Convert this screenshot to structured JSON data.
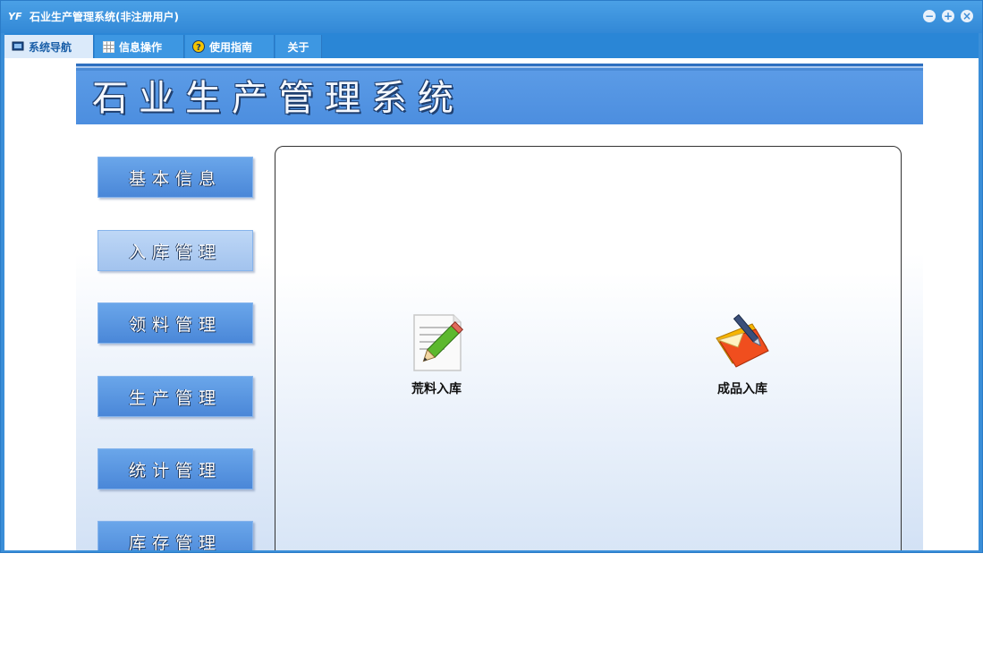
{
  "window": {
    "title": "石业生产管理系统(非注册用户)",
    "logo_text": "YF"
  },
  "controls": {
    "minimize": "−",
    "maximize": "+",
    "close": "×"
  },
  "menu": {
    "tabs": [
      {
        "label": "系统导航",
        "icon": "monitor-icon"
      },
      {
        "label": "信息操作",
        "icon": "grid-icon"
      },
      {
        "label": "使用指南",
        "icon": "help-icon"
      },
      {
        "label": "关于"
      }
    ]
  },
  "banner": {
    "title": "石业生产管理系统"
  },
  "sidebar": {
    "items": [
      {
        "label": "基本信息"
      },
      {
        "label": "入库管理"
      },
      {
        "label": "领料管理"
      },
      {
        "label": "生产管理"
      },
      {
        "label": "统计管理"
      },
      {
        "label": "库存管理"
      }
    ]
  },
  "panel": {
    "shortcuts": [
      {
        "label": "荒料入库",
        "icon": "document-pencil-icon"
      },
      {
        "label": "成品入库",
        "icon": "folder-pen-icon"
      }
    ]
  },
  "colors": {
    "title_bar": "#3a8ed8",
    "menu_bar": "#2a86d6",
    "banner": "#5393e3",
    "side_button": "#5a97e1"
  }
}
